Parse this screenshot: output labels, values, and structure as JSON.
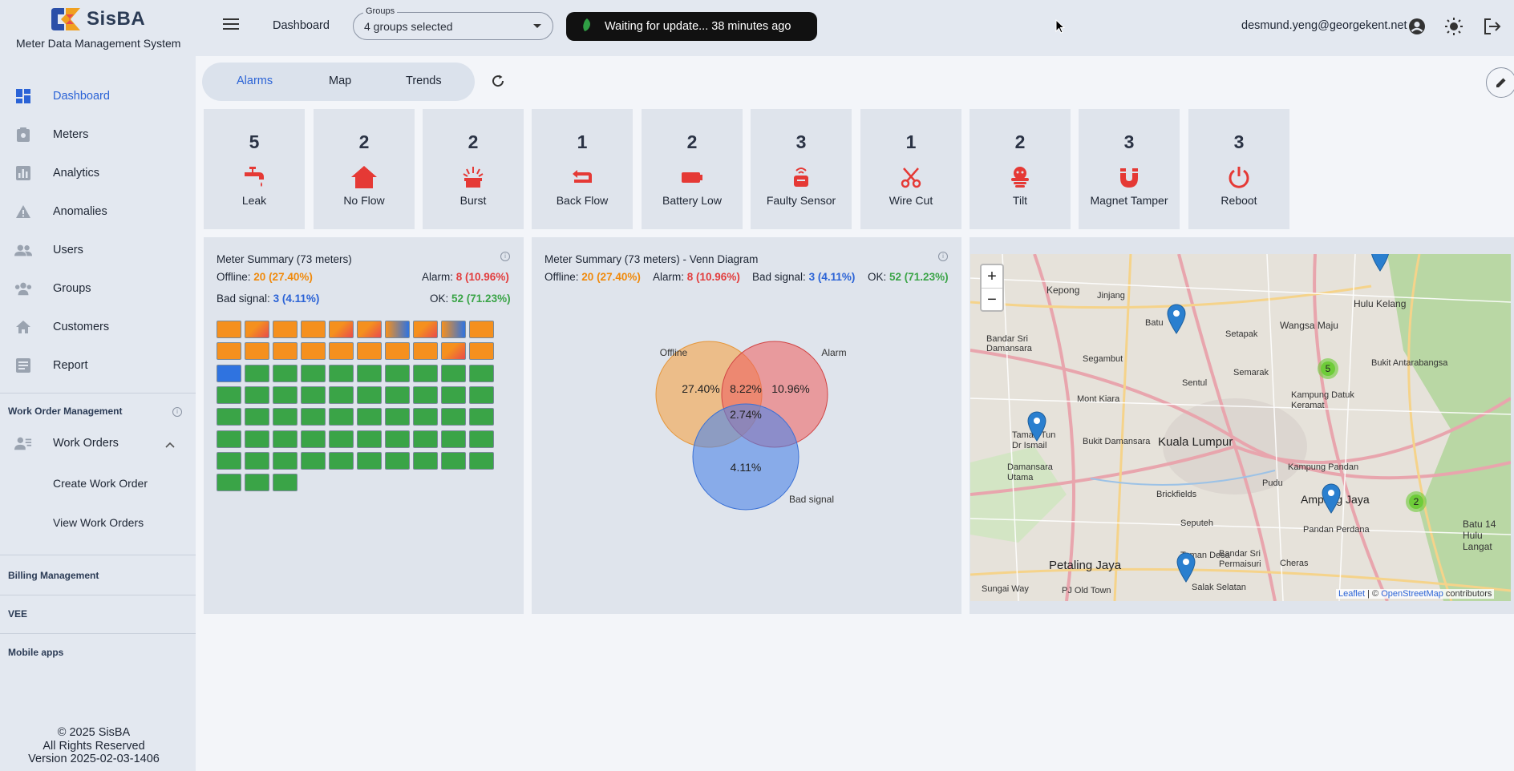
{
  "app": {
    "name": "SisBA",
    "subtitle": "Meter Data Management System"
  },
  "sidebar": {
    "items": [
      {
        "label": "Dashboard",
        "icon": "dashboard-icon",
        "active": true
      },
      {
        "label": "Meters",
        "icon": "meter-icon"
      },
      {
        "label": "Analytics",
        "icon": "analytics-icon"
      },
      {
        "label": "Anomalies",
        "icon": "warning-icon"
      },
      {
        "label": "Users",
        "icon": "users-icon"
      },
      {
        "label": "Groups",
        "icon": "groups-icon"
      },
      {
        "label": "Customers",
        "icon": "home-icon"
      },
      {
        "label": "Report",
        "icon": "report-icon"
      }
    ],
    "work_order_section": "Work Order Management",
    "work_orders_label": "Work Orders",
    "create_work_order": "Create Work Order",
    "view_work_orders": "View Work Orders",
    "billing_section": "Billing Management",
    "vee_section": "VEE",
    "mobile_section": "Mobile apps",
    "footer": {
      "copyright": "© 2025 SisBA",
      "rights": "All Rights Reserved",
      "version": "Version 2025-02-03-1406"
    }
  },
  "topbar": {
    "breadcrumb": "Dashboard",
    "groups_label": "Groups",
    "groups_value": "4 groups selected",
    "status_message": "Waiting for update... 38 minutes ago",
    "user_email": "desmund.yeng@georgekent.net"
  },
  "tabs": [
    {
      "label": "Alarms",
      "active": true
    },
    {
      "label": "Map"
    },
    {
      "label": "Trends"
    }
  ],
  "alarm_cards": [
    {
      "count": "5",
      "label": "Leak",
      "icon": "faucet-leak-icon"
    },
    {
      "count": "2",
      "label": "No Flow",
      "icon": "home-icon"
    },
    {
      "count": "2",
      "label": "Burst",
      "icon": "burst-icon"
    },
    {
      "count": "1",
      "label": "Back Flow",
      "icon": "back-flow-icon"
    },
    {
      "count": "2",
      "label": "Battery Low",
      "icon": "battery-low-icon"
    },
    {
      "count": "3",
      "label": "Faulty Sensor",
      "icon": "faulty-sensor-icon"
    },
    {
      "count": "1",
      "label": "Wire Cut",
      "icon": "scissors-icon"
    },
    {
      "count": "2",
      "label": "Tilt",
      "icon": "tilt-icon"
    },
    {
      "count": "3",
      "label": "Magnet Tamper",
      "icon": "magnet-icon"
    },
    {
      "count": "3",
      "label": "Reboot",
      "icon": "power-icon"
    }
  ],
  "summary": {
    "title": "Meter Summary (73 meters)",
    "offline_label": "Offline:",
    "offline_value": "20 (27.40%)",
    "alarm_label": "Alarm:",
    "alarm_value": "8 (10.96%)",
    "bad_signal_label": "Bad signal:",
    "bad_signal_value": "3 (4.11%)",
    "ok_label": "OK:",
    "ok_value": "52 (71.23%)",
    "cells": {
      "offline": 17,
      "offline_alarm": 3,
      "bad_signal": 1,
      "ok": 52
    }
  },
  "venn": {
    "title": "Meter Summary (73 meters) - Venn Diagram",
    "offline_label": "Offline",
    "alarm_label": "Alarm",
    "bad_signal_label": "Bad signal",
    "offline_pct": "27.40%",
    "alarm_pct": "10.96%",
    "bad_signal_pct": "4.11%",
    "offline_alarm_pct": "8.22%",
    "triple_pct": "2.74%"
  },
  "map": {
    "zoom_in": "+",
    "zoom_out": "−",
    "attribution_leaflet": "Leaflet",
    "attribution_sep": "| ©",
    "attribution_osm": "OpenStreetMap",
    "attribution_tail": "contributors",
    "places": [
      "Kepong",
      "Jinjang",
      "Batu",
      "Setapak",
      "Wangsa Maju",
      "Hulu Kelang",
      "Bukit Antarabangsa",
      "Bandar Sri Damansara",
      "Segambut",
      "Semarak",
      "Sentul",
      "Kampung Datuk Keramat",
      "Mont Kiara",
      "Bukit Damansara",
      "Kuala Lumpur",
      "Taman Tun Dr Ismail",
      "Damansara Utama",
      "Brickfields",
      "Pudu",
      "Kampung Pandan",
      "Ampang Jaya",
      "Pandan Perdana",
      "Seputeh",
      "Petaling Jaya",
      "Taman Desa",
      "Bandar Sri Permaisuri",
      "Salak Selatan",
      "Cheras",
      "Sungai Way",
      "PJ Old Town",
      "Batu 14 Hulu Langat"
    ],
    "clusters": [
      {
        "count": "5"
      },
      {
        "count": "2"
      }
    ]
  },
  "colors": {
    "accent": "#2b63d6",
    "offline": "#f5901e",
    "alarm": "#e84c4c",
    "bad_signal": "#2f73e0",
    "ok": "#3aa447",
    "alarm_icon": "#e53935"
  }
}
